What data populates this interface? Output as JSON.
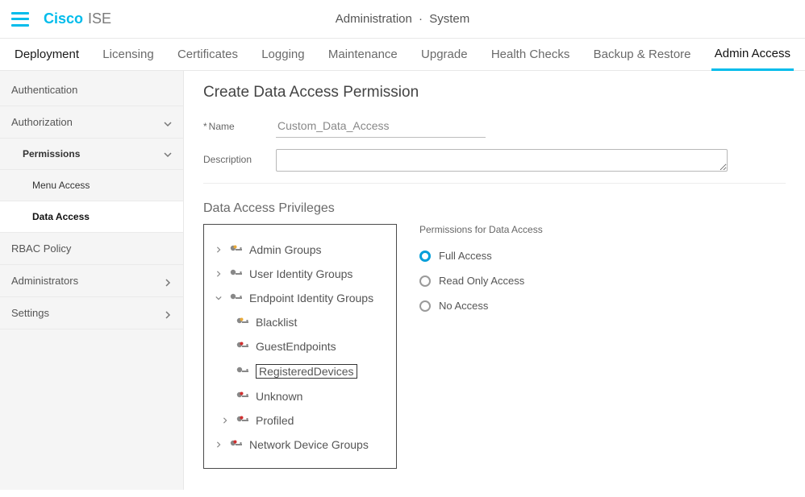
{
  "brand": {
    "cisco": "Cisco",
    "ise": "ISE"
  },
  "breadcrumb": {
    "section": "Administration",
    "page": "System"
  },
  "tabs": [
    {
      "label": "Deployment"
    },
    {
      "label": "Licensing"
    },
    {
      "label": "Certificates"
    },
    {
      "label": "Logging"
    },
    {
      "label": "Maintenance"
    },
    {
      "label": "Upgrade"
    },
    {
      "label": "Health Checks"
    },
    {
      "label": "Backup & Restore"
    },
    {
      "label": "Admin Access"
    }
  ],
  "sidebar": {
    "authentication": "Authentication",
    "authorization": "Authorization",
    "permissions": "Permissions",
    "menu_access": "Menu Access",
    "data_access": "Data Access",
    "rbac_policy": "RBAC Policy",
    "administrators": "Administrators",
    "settings": "Settings"
  },
  "main": {
    "title": "Create Data Access Permission",
    "name_label": "Name",
    "name_value": "Custom_Data_Access",
    "desc_label": "Description",
    "privs_label": "Data Access Privileges",
    "perm_header": "Permissions for Data Access",
    "radios": {
      "full": "Full Access",
      "read": "Read Only Access",
      "none": "No Access"
    },
    "tree": {
      "admin_groups": "Admin Groups",
      "user_identity_groups": "User Identity Groups",
      "endpoint_identity_groups": "Endpoint Identity Groups",
      "blacklist": "Blacklist",
      "guest_endpoints": "GuestEndpoints",
      "registered_devices": "RegisteredDevices",
      "unknown": "Unknown",
      "profiled": "Profiled",
      "network_device_groups": "Network Device Groups"
    }
  }
}
